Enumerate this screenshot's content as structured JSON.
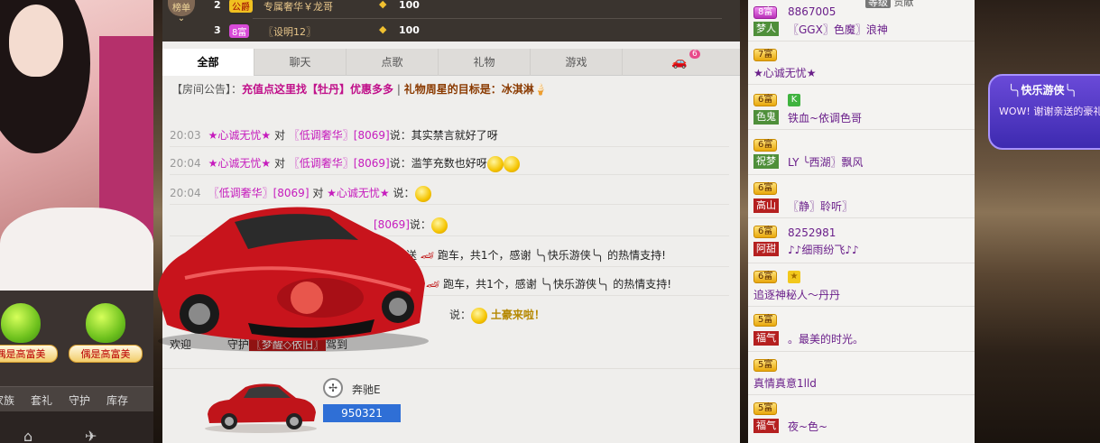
{
  "ranking": {
    "toggle_label": "榜单",
    "rows": [
      {
        "rank": "2",
        "level": "公爵",
        "name": "专属奢华￥龙哥",
        "value": "100"
      },
      {
        "rank": "3",
        "level": "8富",
        "name": "〖设明12〗",
        "value": "100"
      }
    ]
  },
  "badges": [
    {
      "label": "偶是高富美"
    },
    {
      "label": "偶是高富美"
    }
  ],
  "left_tabs": [
    "家族",
    "套礼",
    "守护",
    "库存"
  ],
  "tabs": [
    {
      "label": "全部",
      "active": true
    },
    {
      "label": "聊天"
    },
    {
      "label": "点歌"
    },
    {
      "label": "礼物"
    },
    {
      "label": "游戏"
    }
  ],
  "car_tab_count": "6",
  "notice": {
    "prefix": "【房间公告】：",
    "link": "充值点这里找【牡丹】优惠多多",
    "star": "礼物周星的目标是：冰淇淋"
  },
  "messages": [
    {
      "time": "20:03",
      "from": "★心诚无忧★",
      "to_word": "对",
      "to": "〖低调奢华〗[8069]",
      "said": "说：",
      "text": "其实禁言就好了呀"
    },
    {
      "time": "20:04",
      "from": "★心诚无忧★",
      "to_word": "对",
      "to": "〖低调奢华〗[8069]",
      "said": "说：",
      "text": "滥竽充数也好呀"
    },
    {
      "time": "20:04",
      "from": "〖低调奢华〗[8069]",
      "to_word": "对",
      "to": "★心诚无忧★",
      "said": "说：",
      "text": ""
    },
    {
      "time": "",
      "from": "",
      "to_word": "",
      "to": "[8069]",
      "said": "说：",
      "text": ""
    },
    {
      "time": "",
      "from": "",
      "to_word": "",
      "to": "送",
      "said": "",
      "text": "跑车，共1个，感谢 ╰╮快乐游侠╰╮ 的热情支持!"
    },
    {
      "time": "",
      "from": "",
      "to_word": "",
      "to": "",
      "said": "",
      "text": "跑车，共1个，感谢 ╰╮快乐游侠╰╮ 的热情支持!"
    },
    {
      "time": "",
      "from": "",
      "to_word": "",
      "to": "",
      "said": "说：",
      "text": "土豪来啦！"
    }
  ],
  "welcome": {
    "prefix": "欢迎",
    "mid": "守护",
    "name": "〖梦醒◇依旧〗",
    "suffix": "驾到"
  },
  "car_bar": {
    "brand": "奔驰E",
    "price": "950321"
  },
  "right_list": {
    "top_labels": {
      "level_word": "等级",
      "contrib_word": "贡献"
    },
    "items": [
      {
        "level": "8富",
        "id": "8867005",
        "tag": "梦人",
        "tag_color": "g",
        "name": "〖GGX〗色魔〗浪神"
      },
      {
        "level": "7富",
        "id": "",
        "tag": "",
        "name": "★心诚无忧★"
      },
      {
        "level": "6富",
        "badge": "K",
        "tag": "色鬼",
        "tag_color": "g",
        "name": "铁血~依调色哥"
      },
      {
        "level": "6富",
        "id": "",
        "tag": "祝梦",
        "tag_color": "g",
        "name": "LY ╰西湖〗飘风"
      },
      {
        "level": "6富",
        "id": "",
        "tag": "高山",
        "tag_color": "r",
        "name": "〖静〗聆听〗"
      },
      {
        "level": "6富",
        "id": "8252981",
        "tag": "阿甜",
        "tag_color": "r",
        "name": "♪♪细雨纷飞♪♪"
      },
      {
        "level": "6富",
        "badge": "★",
        "tag": "",
        "name": "追逐神秘人～丹丹"
      },
      {
        "level": "5富",
        "id": "",
        "tag": "福气",
        "tag_color": "r",
        "name": "。最美的时光。"
      },
      {
        "level": "5富",
        "id": "",
        "tag": "",
        "name": "真情真意1lld"
      },
      {
        "level": "5富",
        "id": "",
        "tag": "福气",
        "tag_color": "r",
        "name": "夜~色~"
      }
    ]
  },
  "popup": {
    "title": "╰╮快乐游侠╰╮",
    "body": "WOW! 谢谢亲送的豪礼，好激动咧"
  }
}
